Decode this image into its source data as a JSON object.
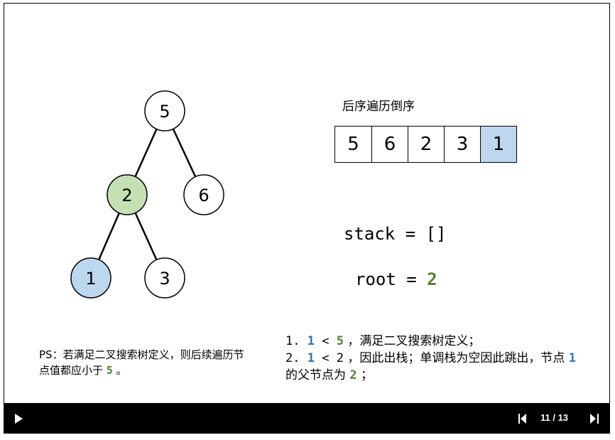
{
  "colors": {
    "highlight_green": "#c5e0b4",
    "highlight_blue": "#bdd7ee",
    "text_green": "#548235",
    "text_blue": "#2e75b6"
  },
  "tree": {
    "nodes": [
      {
        "id": "n5",
        "label": "5",
        "fill": "#ffffff"
      },
      {
        "id": "n2",
        "label": "2",
        "fill": "#c5e0b4"
      },
      {
        "id": "n6",
        "label": "6",
        "fill": "#ffffff"
      },
      {
        "id": "n1",
        "label": "1",
        "fill": "#bdd7ee"
      },
      {
        "id": "n3",
        "label": "3",
        "fill": "#ffffff"
      }
    ],
    "edges": [
      [
        "n5",
        "n2"
      ],
      [
        "n5",
        "n6"
      ],
      [
        "n2",
        "n1"
      ],
      [
        "n2",
        "n3"
      ]
    ]
  },
  "postorder": {
    "title": "后序遍历倒序",
    "cells": [
      {
        "value": "5",
        "fill": "#ffffff"
      },
      {
        "value": "6",
        "fill": "#ffffff"
      },
      {
        "value": "2",
        "fill": "#ffffff"
      },
      {
        "value": "3",
        "fill": "#ffffff"
      },
      {
        "value": "1",
        "fill": "#bdd7ee"
      }
    ]
  },
  "code": {
    "stack_prefix": "stack = ",
    "stack_value": "[]",
    "root_prefix": "root = ",
    "root_value": "2"
  },
  "ps_note": {
    "text": "PS：若满足二叉搜索树定义，则后续遍历节点值都应小于 ",
    "value": "5",
    "suffix": " 。"
  },
  "steps": {
    "line1": {
      "num": "1. ",
      "a": "1",
      "op": " < ",
      "b": "5",
      "text": " ，满足二叉搜索树定义；"
    },
    "line2": {
      "num": "2. ",
      "a": "1",
      "op": " < ",
      "b": "2",
      "text": " ，因此出栈；单调栈为空因此跳出，节点 ",
      "node": "1",
      "text2": " 的父节点为 ",
      "parent": "2",
      "end": " ；"
    }
  },
  "player": {
    "slide_counter": "11 / 13"
  }
}
